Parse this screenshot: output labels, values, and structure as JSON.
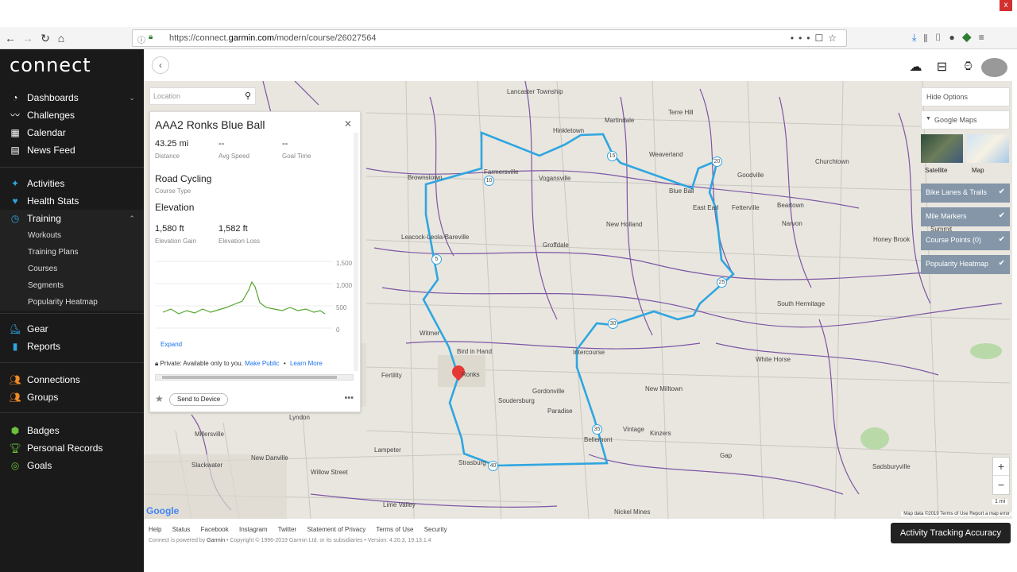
{
  "browser": {
    "url_prefix": "https://connect.",
    "url_domain": "garmin.com",
    "url_path": "/modern/course/26027564",
    "close_label": "x"
  },
  "sidebar": {
    "logo": "connect",
    "sections": [
      {
        "items": [
          {
            "label": "Dashboards",
            "icon": "dashboard-icon"
          },
          {
            "label": "Challenges",
            "icon": "challenges-icon"
          },
          {
            "label": "Calendar",
            "icon": "calendar-icon"
          },
          {
            "label": "News Feed",
            "icon": "newsfeed-icon"
          }
        ]
      },
      {
        "items": [
          {
            "label": "Activities",
            "icon": "activities-icon"
          },
          {
            "label": "Health Stats",
            "icon": "heart-icon"
          },
          {
            "label": "Training",
            "icon": "stopwatch-icon"
          }
        ]
      }
    ],
    "dashboards": "Dashboards",
    "challenges": "Challenges",
    "calendar": "Calendar",
    "newsfeed": "News Feed",
    "activities": "Activities",
    "healthstats": "Health Stats",
    "training": "Training",
    "workouts": "Workouts",
    "trainingplans": "Training Plans",
    "courses": "Courses",
    "segments": "Segments",
    "popularityheatmap": "Popularity Heatmap",
    "gear": "Gear",
    "reports": "Reports",
    "connections": "Connections",
    "groups": "Groups",
    "badges": "Badges",
    "personalrecords": "Personal Records",
    "goals": "Goals"
  },
  "location": {
    "placeholder": "Location"
  },
  "course": {
    "title": "AAA2 Ronks Blue Ball",
    "distance_value": "43.25 mi",
    "distance_label": "Distance",
    "avgspeed_value": "--",
    "avgspeed_label": "Avg Speed",
    "goaltime_value": "--",
    "goaltime_label": "Goal Time",
    "type_value": "Road Cycling",
    "type_label": "Course Type",
    "elevation_heading": "Elevation",
    "gain_value": "1,580 ft",
    "gain_label": "Elevation Gain",
    "loss_value": "1,582 ft",
    "loss_label": "Elevation Loss",
    "elev_ticks": [
      "1,500",
      "1,000",
      "500",
      "0"
    ],
    "expand": "Expand",
    "private_text": "Private: Available only to you.",
    "make_public": "Make Public",
    "learn_more": "Learn More",
    "send_to_device": "Send to Device"
  },
  "map_options": {
    "hide_options": "Hide Options",
    "google_maps": "Google Maps",
    "satellite": "Satellite",
    "map": "Map",
    "layers": [
      "Bike Lanes & Trails",
      "Mile Markers",
      "Course Points (0)",
      "Popularity Heatmap"
    ]
  },
  "map": {
    "scale": "1 mi",
    "attribution": "Map data ©2019   Terms of Use   Report a map error",
    "google": "Google",
    "places": [
      "Hinkletown",
      "Martindale",
      "Farmersville",
      "Vogansville",
      "Brownstown",
      "Weaverland",
      "Churchtown",
      "Goodville",
      "Terre Hill",
      "Blue Ball",
      "East Earl",
      "Fetterville",
      "Beartown",
      "Narvon",
      "New Holland",
      "Leacock-Leola-Bareville",
      "Groffdale",
      "Honey Brook",
      "South Hermitage",
      "White Horse",
      "Bird in Hand",
      "Witmer",
      "Fertility",
      "Gordonville",
      "Soudersburg",
      "Paradise",
      "New Milltown",
      "Vintage",
      "Kinzers",
      "Bellemont",
      "Gap",
      "Sadsburyville",
      "Strasburg",
      "Lampeter",
      "New Danville",
      "Willow Street",
      "Millersville",
      "Lyndon",
      "Slackwater",
      "Lime Valley",
      "Nickel Mines",
      "Lancaster Township",
      "Intercourse",
      "Ronks",
      "Summit"
    ]
  },
  "footer": {
    "links": [
      "Help",
      "Status",
      "Facebook",
      "Instagram",
      "Twitter",
      "Statement of Privacy",
      "Terms of Use",
      "Security"
    ],
    "copyright_prefix": "Connect is powered by ",
    "copyright_brand": "Garmin",
    "copyright_suffix": " • Copyright © 1996-2019 Garmin Ltd. or its subsidiaries • Version: 4.20.3, 19.13.1.4",
    "accuracy_button": "Activity Tracking Accuracy"
  }
}
